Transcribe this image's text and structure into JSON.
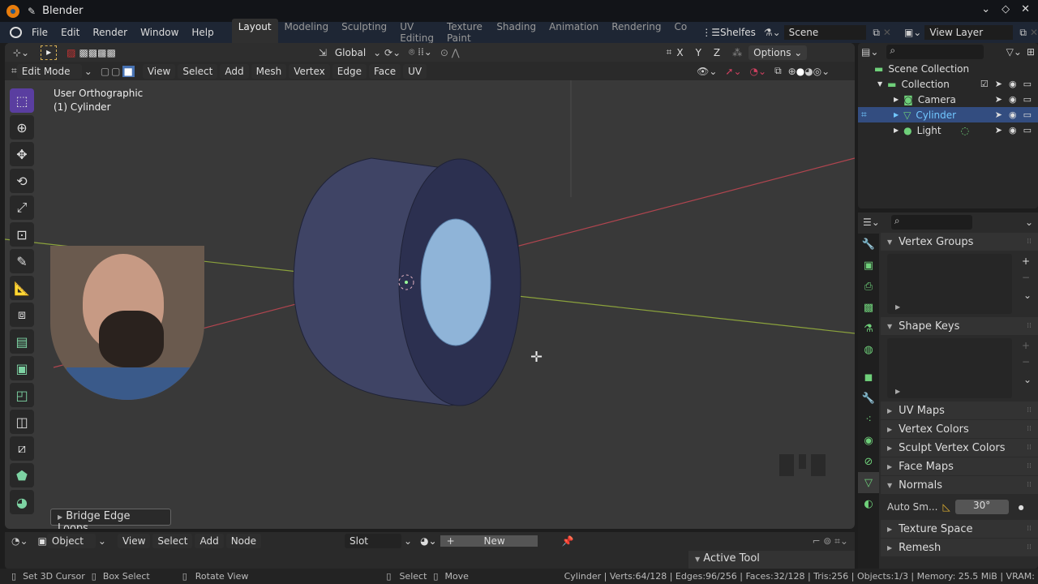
{
  "app": {
    "title": "Blender"
  },
  "window_controls": [
    "minimize",
    "maximize",
    "close"
  ],
  "menubar": {
    "menus": [
      "File",
      "Edit",
      "Render",
      "Window",
      "Help"
    ],
    "workspaces": [
      "Layout",
      "Modeling",
      "Sculpting",
      "UV Editing",
      "Texture Paint",
      "Shading",
      "Animation",
      "Rendering",
      "Co"
    ],
    "active_workspace": "Layout",
    "shelfes_label": "Shelfes",
    "scene": "Scene",
    "view_layer": "View Layer"
  },
  "viewport": {
    "tool_header": {
      "orientation": "Global",
      "axes": [
        "X",
        "Y",
        "Z"
      ],
      "options_label": "Options"
    },
    "header": {
      "mode": "Edit Mode",
      "menus": [
        "View",
        "Select",
        "Add",
        "Mesh",
        "Vertex",
        "Edge",
        "Face",
        "UV"
      ]
    },
    "overlay_text": {
      "view_name": "User Orthographic",
      "object": "(1) Cylinder"
    },
    "last_operator": "Bridge Edge Loops",
    "tools": [
      "select-box",
      "cursor",
      "move",
      "rotate",
      "scale",
      "transform",
      "annotate",
      "measure",
      "add-cube",
      "extrude",
      "inset",
      "bevel",
      "loop-cut",
      "knife",
      "poly-build",
      "spin"
    ]
  },
  "outliner": {
    "items": [
      {
        "label": "Scene Collection",
        "level": 0
      },
      {
        "label": "Collection",
        "level": 1
      },
      {
        "label": "Camera",
        "level": 2
      },
      {
        "label": "Cylinder",
        "level": 2,
        "selected": true
      },
      {
        "label": "Light",
        "level": 2
      }
    ]
  },
  "properties": {
    "panels": [
      {
        "label": "Vertex Groups",
        "expanded": true
      },
      {
        "label": "Shape Keys",
        "expanded": true
      },
      {
        "label": "UV Maps",
        "expanded": false
      },
      {
        "label": "Vertex Colors",
        "expanded": false
      },
      {
        "label": "Sculpt Vertex Colors",
        "expanded": false
      },
      {
        "label": "Face Maps",
        "expanded": false
      },
      {
        "label": "Normals",
        "expanded": true
      },
      {
        "label": "Texture Space",
        "expanded": false
      },
      {
        "label": "Remesh",
        "expanded": false
      }
    ],
    "auto_smooth": {
      "label": "Auto Sm...",
      "value": "30°"
    }
  },
  "node_editor": {
    "editor_type": "Object",
    "menus": [
      "View",
      "Select",
      "Add",
      "Node"
    ],
    "slot": "Slot",
    "new_label": "New",
    "sidebar_panel": "Active Tool"
  },
  "statusbar": {
    "hints": [
      {
        "label": "Set 3D Cursor"
      },
      {
        "label": "Box Select"
      },
      {
        "label": "Rotate View"
      },
      {
        "label": "Select"
      },
      {
        "label": "Move"
      }
    ],
    "stats": "Cylinder | Verts:64/128 | Edges:96/256 | Faces:32/128 | Tris:256 | Objects:1/3 | Memory: 25.5 MiB | VRAM: "
  },
  "colors": {
    "accent_select": "#334d80",
    "accent_text": "#71c7ff",
    "tool_active": "#5a3ea0",
    "mesh": "#3a3f5e",
    "x_axis": "#b0454f",
    "y_axis": "#8ba23c"
  }
}
